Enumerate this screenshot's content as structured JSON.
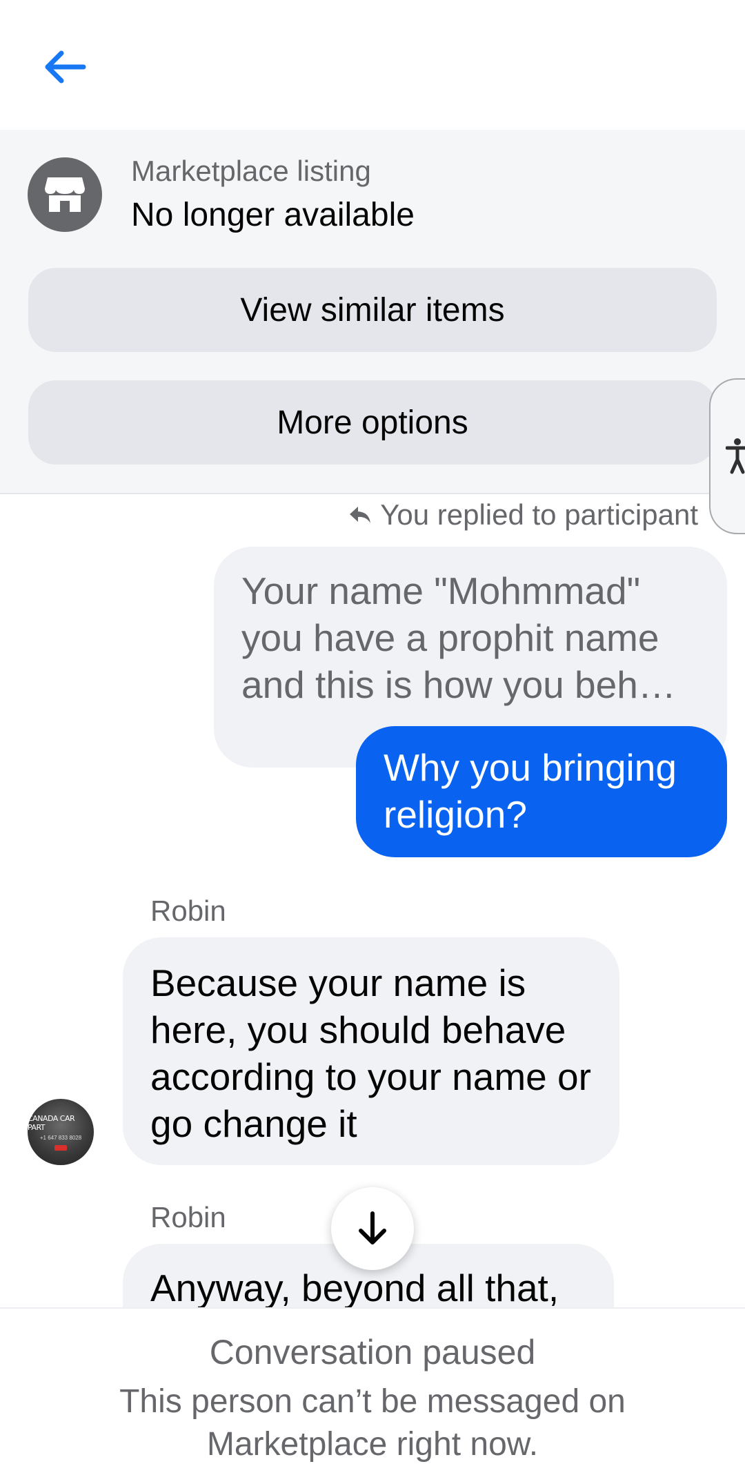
{
  "header": {
    "back_icon": "arrow-left-icon",
    "accent": "#1877F2"
  },
  "listing": {
    "icon": "storefront-icon",
    "kicker": "Marketplace listing",
    "status": "No longer available",
    "view_similar_label": "View similar items",
    "more_options_label": "More options"
  },
  "accessibility": {
    "icon": "accessibility-person-icon"
  },
  "thread": {
    "reply_note": "You replied to participant",
    "reply_icon": "reply-arrow-icon",
    "quoted_message": "Your name \"Mohmmad\" you have a prophit name and this is how you beh…",
    "my_message": "Why you bringing religion?",
    "messages": [
      {
        "sender": "Robin",
        "text": "Because your name is here, you should behave according to your name or go change it"
      },
      {
        "sender": "Robin",
        "text": "Anyway, beyond all that,"
      }
    ],
    "avatar_text": "CANADA CAR PART",
    "avatar_subtext": "+1 647 833 8028"
  },
  "scroll_button": {
    "icon": "arrow-down-icon"
  },
  "footer": {
    "title": "Conversation paused",
    "body": "This person can’t be messaged on Marketplace right now."
  },
  "colors": {
    "outgoing_bubble": "#0A63F0",
    "incoming_bubble": "#F0F2F5",
    "secondary_text": "#65676B"
  }
}
